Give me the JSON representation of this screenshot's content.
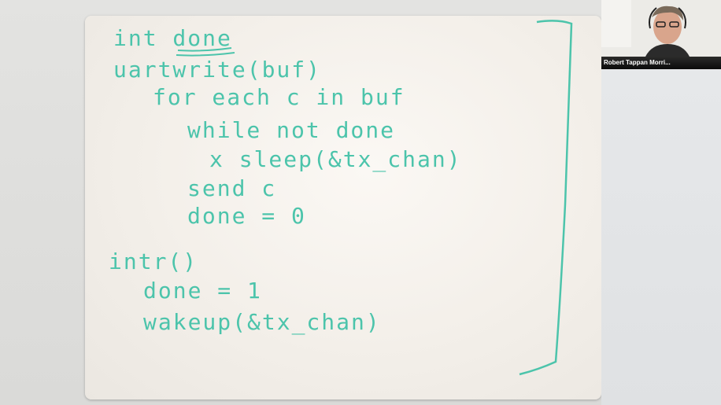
{
  "whiteboard": {
    "lines": [
      "int done",
      "uartwrite(buf)",
      "for each c in buf",
      "while not done",
      "x sleep(&tx_chan)",
      "send c",
      "done = 0",
      "intr()",
      "done = 1",
      "wakeup(&tx_chan)"
    ],
    "ink_color": "#4cc4ab"
  },
  "video": {
    "participant_name": "Robert Tappan Morri..."
  }
}
